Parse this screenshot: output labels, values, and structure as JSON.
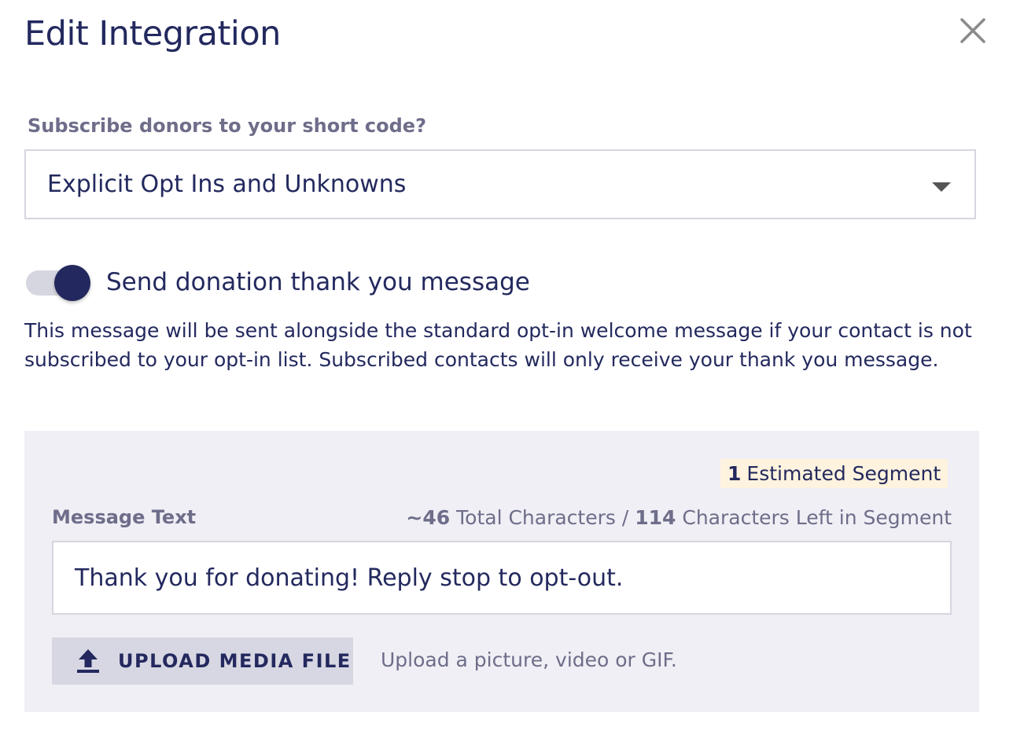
{
  "dialog": {
    "title": "Edit Integration",
    "close_icon": "close-icon"
  },
  "subscribe": {
    "label": "Subscribe donors to your short code?",
    "selected_value": "Explicit Opt Ins and Unknowns",
    "caret_icon": "chevron-down-icon"
  },
  "thank_you_toggle": {
    "label": "Send donation thank you message",
    "enabled": true
  },
  "description": "This message will be sent alongside the standard opt-in welcome message if your contact is not subscribed to your opt-in list. Subscribed contacts will only receive your thank you message.",
  "message_panel": {
    "segment_count": "1",
    "segment_label": "Estimated Segment",
    "message_label": "Message Text",
    "total_characters": "~46",
    "total_characters_label": "Total Characters /",
    "characters_left": "114",
    "characters_left_label": "Characters Left in Segment",
    "message_value": "Thank you for donating! Reply stop to opt-out.",
    "upload_button_label": "UPLOAD MEDIA FILE",
    "upload_icon": "upload-icon",
    "upload_hint": "Upload a picture, video or GIF."
  },
  "colors": {
    "primary": "#23295e",
    "muted_text": "#6e6d8a",
    "panel_bg": "#efeff5",
    "badge_bg": "#fdf3de",
    "border": "#d6d6e0"
  }
}
